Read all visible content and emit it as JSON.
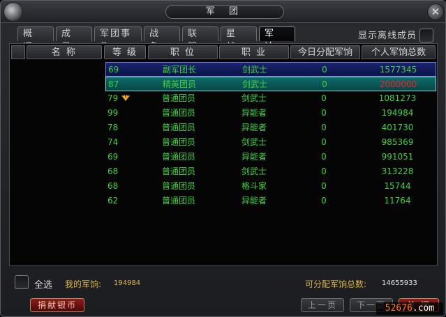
{
  "window": {
    "title": "军 团"
  },
  "tabs": [
    {
      "label": "概 况"
    },
    {
      "label": "成 员"
    },
    {
      "label": "军团事件"
    },
    {
      "label": "战 争"
    },
    {
      "label": "联 盟"
    },
    {
      "label": "星 战"
    },
    {
      "label": "军 饷",
      "active": true
    }
  ],
  "show_offline_label": "显示离线成员",
  "table": {
    "headers": {
      "name": "名 称",
      "level": "等 级",
      "position": "职 位",
      "job": "职 业",
      "today": "今日分配军饷",
      "total": "个人军饷总数"
    },
    "rows": [
      {
        "level": "69",
        "position": "副军团长",
        "job": "剑武士",
        "today": "0",
        "total": "1577345"
      },
      {
        "level": "87",
        "position": "精英团员",
        "job": "剑武士",
        "today": "0",
        "total": "2000000"
      },
      {
        "level": "79",
        "position": "普通团员",
        "job": "剑武士",
        "today": "0",
        "total": "1081273"
      },
      {
        "level": "99",
        "position": "普通团员",
        "job": "异能者",
        "today": "0",
        "total": "194984"
      },
      {
        "level": "78",
        "position": "普通团员",
        "job": "异能者",
        "today": "0",
        "total": "401730"
      },
      {
        "level": "74",
        "position": "普通团员",
        "job": "剑武士",
        "today": "0",
        "total": "985369"
      },
      {
        "level": "69",
        "position": "普通团员",
        "job": "异能者",
        "today": "0",
        "total": "991051"
      },
      {
        "level": "68",
        "position": "普通团员",
        "job": "剑武士",
        "today": "0",
        "total": "313228"
      },
      {
        "level": "68",
        "position": "普通团员",
        "job": "格斗家",
        "today": "0",
        "total": "15744"
      },
      {
        "level": "62",
        "position": "普通团员",
        "job": "异能者",
        "today": "0",
        "total": "11764"
      }
    ]
  },
  "footer": {
    "select_all": "全选",
    "my_salary_label": "我的军饷:",
    "my_salary_value": "194984",
    "distributable_label": "可分配军饷总数:",
    "distributable_value": "14655933",
    "donate_button": "捐献银币",
    "prev_button": "上一页",
    "next_button": "下一页",
    "close_button": "关 闭"
  },
  "watermark": {
    "prefix": "52",
    "accent": "676",
    "suffix": ".com"
  },
  "colors": {
    "member_green": "#3ed23e",
    "max_red": "#ff1f1f",
    "gold_label": "#d9b24a"
  }
}
